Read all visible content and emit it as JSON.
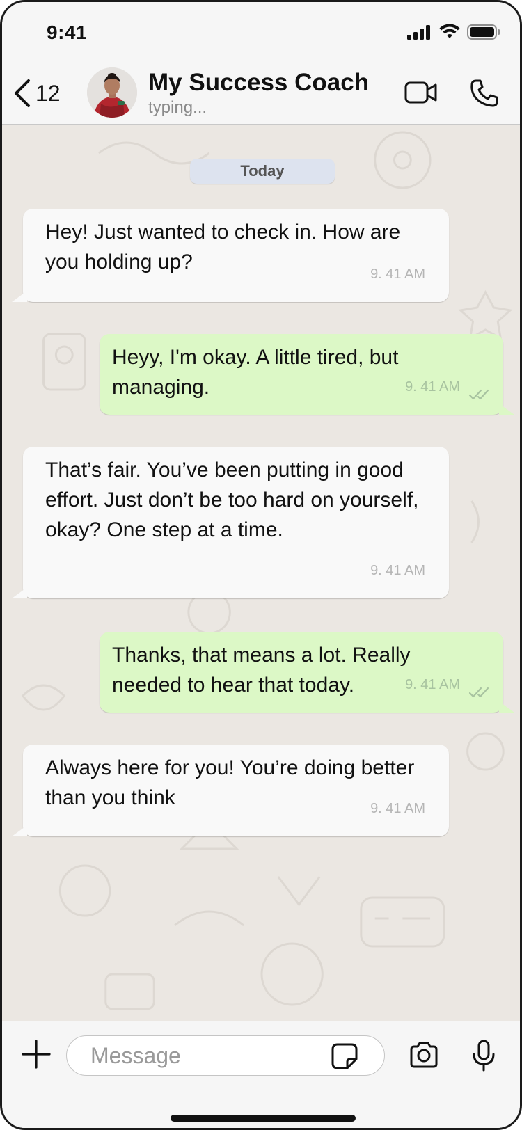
{
  "status_bar": {
    "time": "9:41"
  },
  "header": {
    "back_count": "12",
    "contact_name": "My Success Coach",
    "contact_status": "typing..."
  },
  "chat": {
    "date_label": "Today",
    "messages": [
      {
        "direction": "in",
        "text": "Hey! Just wanted to check in. How are you holding up?",
        "time": "9. 41 AM"
      },
      {
        "direction": "out",
        "text": "Heyy, I'm okay. A little tired, but managing.",
        "time": "9. 41 AM",
        "status": "read-double-tick"
      },
      {
        "direction": "in",
        "text": "That’s fair. You’ve been putting in good effort. Just don’t be too hard on yourself, okay? One step at a time.",
        "time": "9. 41 AM"
      },
      {
        "direction": "out",
        "text": "Thanks, that means a lot. Really needed to hear that today.",
        "time": "9. 41 AM",
        "status": "read-double-tick"
      },
      {
        "direction": "in",
        "text": "Always here for you! You’re doing better than you think",
        "time": "9. 41 AM"
      }
    ]
  },
  "composer": {
    "placeholder": "Message"
  },
  "icons": {
    "back": "chevron-left-icon",
    "video": "video-camera-icon",
    "call": "phone-icon",
    "plus": "plus-icon",
    "sticker": "sticker-icon",
    "camera": "camera-icon",
    "mic": "microphone-icon"
  },
  "colors": {
    "incoming_bubble": "#f9f9f9",
    "outgoing_bubble": "#dcf8c6",
    "chat_background": "#ebe7e2",
    "date_pill": "#dde3ef"
  }
}
